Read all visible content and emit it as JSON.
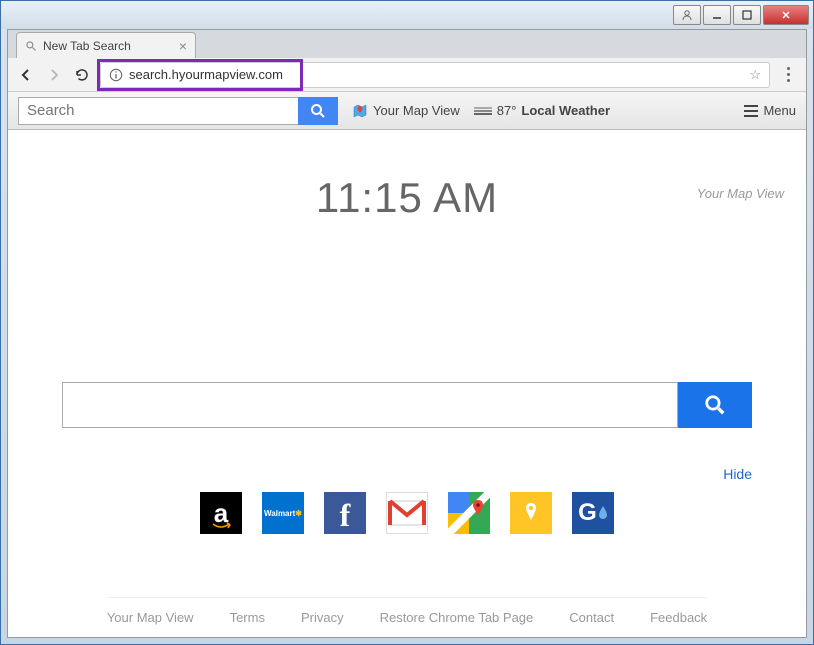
{
  "window": {
    "tab_title": "New Tab Search"
  },
  "browser": {
    "url": "search.hyourmapview.com"
  },
  "toolbar": {
    "search_placeholder": "Search",
    "map_label": "Your Map View",
    "temp": "87°",
    "weather_label": "Local Weather",
    "menu_label": "Menu"
  },
  "page": {
    "clock": "11:15 AM",
    "brand": "Your Map View",
    "hide_label": "Hide",
    "tiles": [
      {
        "name": "amazon",
        "bg": "#000000",
        "letter": "a"
      },
      {
        "name": "walmart",
        "bg": "#0071ce",
        "letter": "Walmart"
      },
      {
        "name": "facebook",
        "bg": "#3b5998",
        "letter": "f"
      },
      {
        "name": "gmail",
        "bg": "#ffffff",
        "letter": "M"
      },
      {
        "name": "google-maps",
        "bg": "#ffffff",
        "letter": ""
      },
      {
        "name": "yellow-pages",
        "bg": "#ffc425",
        "letter": ""
      },
      {
        "name": "gasbuddy",
        "bg": "#2050a0",
        "letter": "G"
      }
    ]
  },
  "footer": {
    "links": [
      "Your Map View",
      "Terms",
      "Privacy",
      "Restore Chrome Tab Page",
      "Contact",
      "Feedback"
    ]
  }
}
